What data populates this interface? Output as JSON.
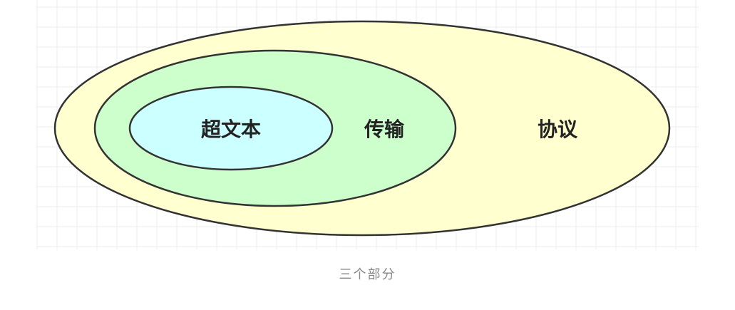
{
  "diagram": {
    "layers": [
      {
        "id": "outer",
        "label": "协议",
        "fill": "#ffffd0"
      },
      {
        "id": "middle",
        "label": "传输",
        "fill": "#ccffcc"
      },
      {
        "id": "inner",
        "label": "超文本",
        "fill": "#ccffff"
      }
    ],
    "grid_color": "#eeeeee",
    "stroke_color": "#333333"
  },
  "caption": "三个部分"
}
